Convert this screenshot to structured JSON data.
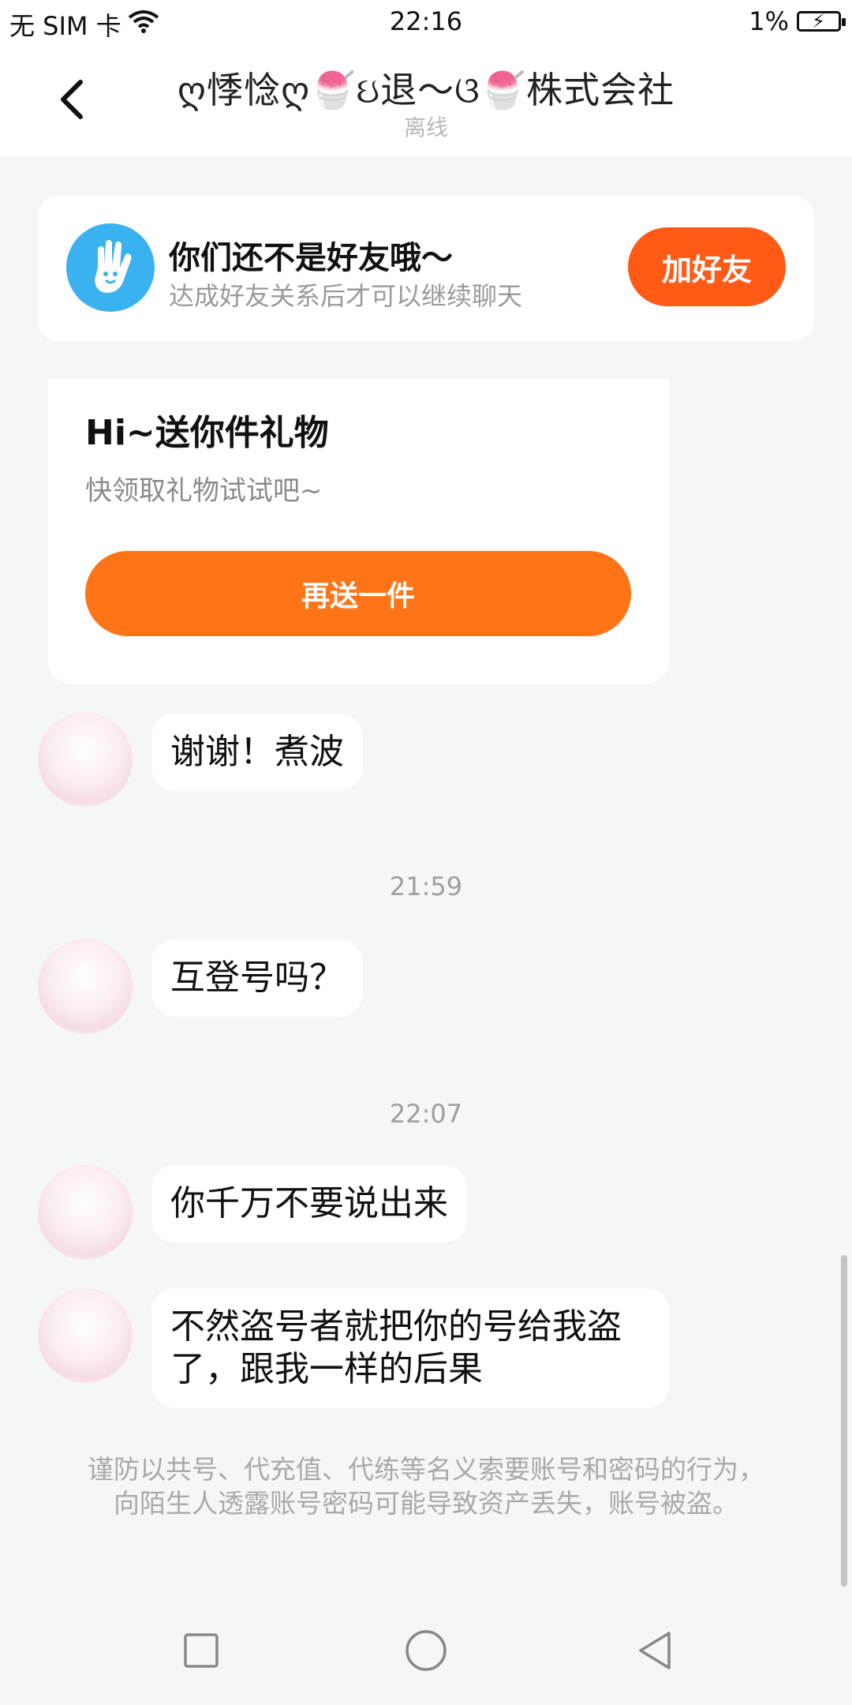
{
  "status_bar": {
    "carrier": "无 SIM 卡",
    "time": "22:16",
    "battery": "1%"
  },
  "header": {
    "title": "ღ悸惗ღ🍧ઇ退～ଓ🍧株式会社",
    "status": "离线"
  },
  "friend_card": {
    "title": "你们还不是好友哦～",
    "subtitle": "达成好友关系后才可以继续聊天",
    "button": "加好友"
  },
  "gift_card": {
    "title": "Hi~送你件礼物",
    "subtitle": "快领取礼物试试吧~",
    "button": "再送一件"
  },
  "messages": [
    {
      "text": "谢谢！煮波"
    },
    {
      "timestamp": "21:59"
    },
    {
      "text": "互登号吗？"
    },
    {
      "timestamp": "22:07"
    },
    {
      "text": "你千万不要说出来"
    },
    {
      "text": "不然盗号者就把你的号给我盗了，跟我一样的后果"
    }
  ],
  "notice": "谨防以共号、代充值、代练等名义索要账号和密码的行为，向陌生人透露账号密码可能导致资产丢失，账号被盗。",
  "colors": {
    "accent_orange": "#ff5a16",
    "gift_orange": "#ff7416",
    "hand_blue": "#3ab2ef",
    "background": "#f5f6f8"
  },
  "icons": [
    "wifi-icon",
    "battery-icon",
    "back-arrow-icon",
    "hand-wave-icon",
    "nav-square-icon",
    "nav-home-icon",
    "nav-back-icon"
  ]
}
